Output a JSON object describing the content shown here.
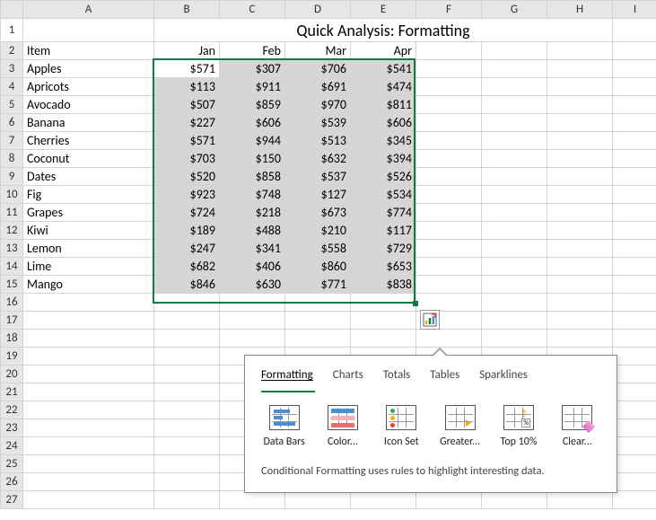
{
  "cols": [
    "A",
    "B",
    "C",
    "D",
    "E",
    "F",
    "G",
    "H",
    "I"
  ],
  "title": "Quick Analysis: Formatting",
  "h_item": "Item",
  "months": {
    "jan": "Jan",
    "feb": "Feb",
    "mar": "Mar",
    "apr": "Apr"
  },
  "rows": [
    {
      "n": "3",
      "item": "Apples",
      "v": [
        "$571",
        "$307",
        "$706",
        "$541"
      ]
    },
    {
      "n": "4",
      "item": "Apricots",
      "v": [
        "$113",
        "$911",
        "$691",
        "$474"
      ]
    },
    {
      "n": "5",
      "item": "Avocado",
      "v": [
        "$507",
        "$859",
        "$970",
        "$811"
      ]
    },
    {
      "n": "6",
      "item": "Banana",
      "v": [
        "$227",
        "$606",
        "$539",
        "$606"
      ]
    },
    {
      "n": "7",
      "item": "Cherries",
      "v": [
        "$571",
        "$944",
        "$513",
        "$345"
      ]
    },
    {
      "n": "8",
      "item": "Coconut",
      "v": [
        "$703",
        "$150",
        "$632",
        "$394"
      ]
    },
    {
      "n": "9",
      "item": "Dates",
      "v": [
        "$520",
        "$858",
        "$537",
        "$526"
      ]
    },
    {
      "n": "10",
      "item": "Fig",
      "v": [
        "$923",
        "$748",
        "$127",
        "$534"
      ]
    },
    {
      "n": "11",
      "item": "Grapes",
      "v": [
        "$724",
        "$218",
        "$673",
        "$774"
      ]
    },
    {
      "n": "12",
      "item": "Kiwi",
      "v": [
        "$189",
        "$488",
        "$210",
        "$117"
      ]
    },
    {
      "n": "13",
      "item": "Lemon",
      "v": [
        "$247",
        "$341",
        "$558",
        "$729"
      ]
    },
    {
      "n": "14",
      "item": "Lime",
      "v": [
        "$682",
        "$406",
        "$860",
        "$653"
      ]
    },
    {
      "n": "15",
      "item": "Mango",
      "v": [
        "$846",
        "$630",
        "$771",
        "$838"
      ]
    }
  ],
  "emptyRows": [
    "16",
    "17",
    "18",
    "19",
    "20",
    "21",
    "22",
    "23",
    "24",
    "25",
    "26",
    "27"
  ],
  "qa": {
    "tabs": {
      "formatting": "Formatting",
      "charts": "Charts",
      "totals": "Totals",
      "tables": "Tables",
      "sparklines": "Sparklines"
    },
    "opts": {
      "databars": "Data Bars",
      "color": "Color...",
      "iconset": "Icon Set",
      "greater": "Greater...",
      "top": "Top 10%",
      "clear": "Clear..."
    },
    "footer": "Conditional Formatting uses rules to highlight interesting data."
  }
}
